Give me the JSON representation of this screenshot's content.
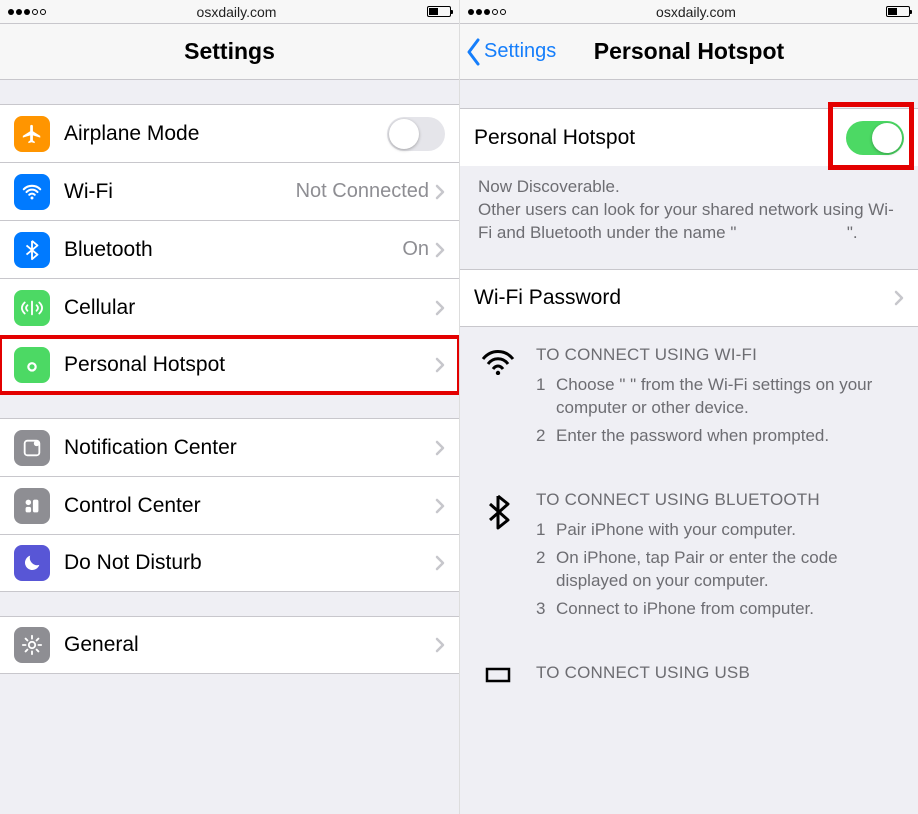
{
  "statusbar": {
    "domain": "osxdaily.com"
  },
  "left": {
    "title": "Settings",
    "rows_g1": [
      {
        "id": "airplane",
        "label": "Airplane Mode",
        "icon": "airplane-icon",
        "color": "c-orange",
        "ctrl": "toggle",
        "on": false
      },
      {
        "id": "wifi",
        "label": "Wi-Fi",
        "icon": "wifi-icon",
        "color": "c-blue",
        "ctrl": "value",
        "value": "Not Connected"
      },
      {
        "id": "bluetooth",
        "label": "Bluetooth",
        "icon": "bluetooth-icon",
        "color": "c-blue",
        "ctrl": "value",
        "value": "On"
      },
      {
        "id": "cellular",
        "label": "Cellular",
        "icon": "cellular-icon",
        "color": "c-green",
        "ctrl": "chev"
      },
      {
        "id": "hotspot",
        "label": "Personal Hotspot",
        "icon": "hotspot-icon",
        "color": "c-green",
        "ctrl": "chev",
        "highlight": true
      }
    ],
    "rows_g2": [
      {
        "id": "notif",
        "label": "Notification Center",
        "icon": "notification-icon",
        "color": "c-gray",
        "ctrl": "chev"
      },
      {
        "id": "control",
        "label": "Control Center",
        "icon": "control-icon",
        "color": "c-gray",
        "ctrl": "chev"
      },
      {
        "id": "dnd",
        "label": "Do Not Disturb",
        "icon": "moon-icon",
        "color": "c-purple",
        "ctrl": "chev"
      }
    ],
    "rows_g3": [
      {
        "id": "general",
        "label": "General",
        "icon": "gear-icon",
        "color": "c-gray",
        "ctrl": "chev"
      }
    ]
  },
  "right": {
    "back_label": "Settings",
    "title": "Personal Hotspot",
    "toggle_row": {
      "label": "Personal Hotspot",
      "on": true
    },
    "desc1": "Now Discoverable.",
    "desc2_a": "Other users can look for your shared network using Wi-Fi and Bluetooth under the name \"",
    "desc2_b": "\".",
    "wifi_pw_label": "Wi-Fi Password",
    "instr_wifi_title": "TO CONNECT USING WI-FI",
    "instr_wifi": [
      "Choose \"                       \" from the Wi-Fi settings on your computer or other device.",
      "Enter the password when prompted."
    ],
    "instr_bt_title": "TO CONNECT USING BLUETOOTH",
    "instr_bt": [
      "Pair iPhone with your computer.",
      "On iPhone, tap Pair or enter the code displayed on your computer.",
      "Connect to iPhone from computer."
    ],
    "instr_usb_title": "TO CONNECT USING USB"
  }
}
